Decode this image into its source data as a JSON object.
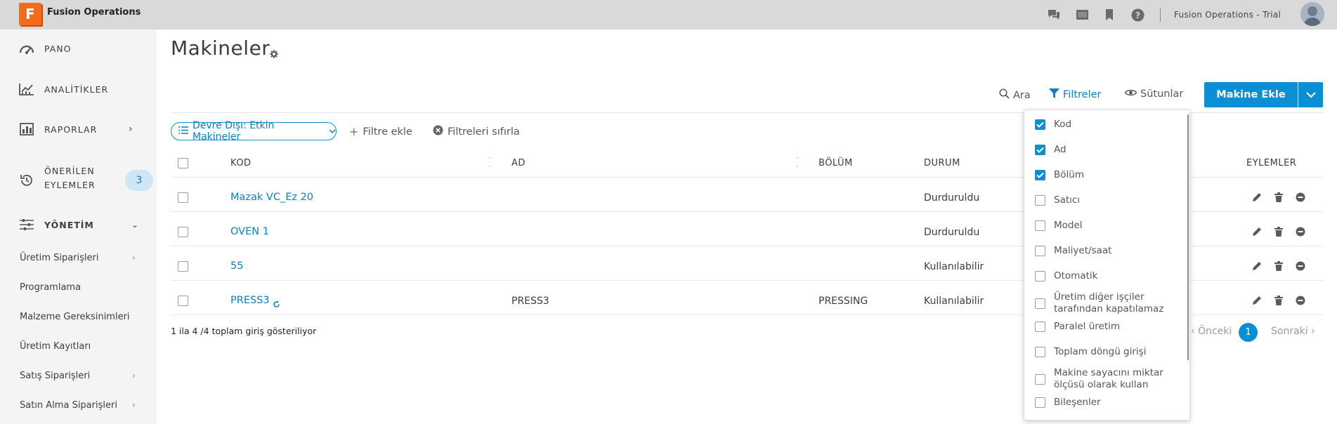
{
  "topbar": {
    "logo_letter": "F",
    "app_name": "Fusion Operations",
    "tenant": "Fusion Operations - Trial",
    "icons": [
      "chat-icon",
      "screen-icon",
      "bookmark-icon",
      "help-icon"
    ]
  },
  "sidebar": {
    "items": [
      {
        "label": "PANO",
        "icon": "dashboard-icon"
      },
      {
        "label": "ANALİTİKLER",
        "icon": "analytics-icon"
      },
      {
        "label": "RAPORLAR",
        "icon": "reports-icon"
      },
      {
        "label": "ÖNERİLEN",
        "label2": "EYLEMLER",
        "icon": "history-icon",
        "badge": "3"
      },
      {
        "label": "YÖNETİM",
        "icon": "sliders-icon"
      }
    ],
    "sub_items": [
      {
        "label": "Üretim Siparişleri",
        "has_chevron": true
      },
      {
        "label": "Programlama",
        "has_chevron": false
      },
      {
        "label": "Malzeme Gereksinimleri",
        "has_chevron": false
      },
      {
        "label": "Üretim Kayıtları",
        "has_chevron": false
      },
      {
        "label": "Satış Siparişleri",
        "has_chevron": true
      },
      {
        "label": "Satın Alma Siparişleri",
        "has_chevron": true
      }
    ]
  },
  "main": {
    "title": "Makineler",
    "toolbar": {
      "search": "Ara",
      "filters": "Filtreler",
      "columns": "Sütunlar",
      "add": "Makine Ekle"
    },
    "filter_bar": {
      "chip": "Devre Dışı: Etkin Makineler",
      "add_filter": "Filtre ekle",
      "reset": "Filtreleri sıfırla"
    },
    "table": {
      "headers": {
        "code": "KOD",
        "name": "AD",
        "section": "BÖLÜM",
        "status": "DURUM",
        "actions": "EYLEMLER"
      },
      "rows": [
        {
          "code": "Mazak VC_Ez 20",
          "name": "",
          "section": "",
          "status": "Durduruldu"
        },
        {
          "code": "OVEN 1",
          "name": "",
          "section": "",
          "status": "Durduruldu"
        },
        {
          "code": "55",
          "name": "",
          "section": "",
          "status": "Kullanılabilir"
        },
        {
          "code": "PRESS3",
          "name": "PRESS3",
          "section": "PRESSING",
          "status": "Kullanılabilir"
        }
      ]
    },
    "summary": "1 ila 4 /4 toplam giriş gösteriliyor",
    "pager": {
      "prev": "Önceki",
      "current": "1",
      "next": "Sonraki"
    }
  },
  "column_menu": {
    "items": [
      {
        "label": "Kod",
        "checked": true
      },
      {
        "label": "Ad",
        "checked": true
      },
      {
        "label": "Bölüm",
        "checked": true
      },
      {
        "label": "Satıcı",
        "checked": false
      },
      {
        "label": "Model",
        "checked": false
      },
      {
        "label": "Maliyet/saat",
        "checked": false
      },
      {
        "label": "Otomatik",
        "checked": false
      },
      {
        "label": "Üretim diğer işçiler tarafından kapatılamaz",
        "checked": false
      },
      {
        "label": "Paralel üretim",
        "checked": false
      },
      {
        "label": "Toplam döngü girişi",
        "checked": false
      },
      {
        "label": "Makine sayacını miktar ölçüsü olarak kullan",
        "checked": false
      },
      {
        "label": "Bileşenler",
        "checked": false
      }
    ]
  },
  "colors": {
    "accent": "#0b8fd4",
    "link": "#0b7fc1",
    "brand": "#f26b1d",
    "sidebar": "#f4f4f4"
  }
}
